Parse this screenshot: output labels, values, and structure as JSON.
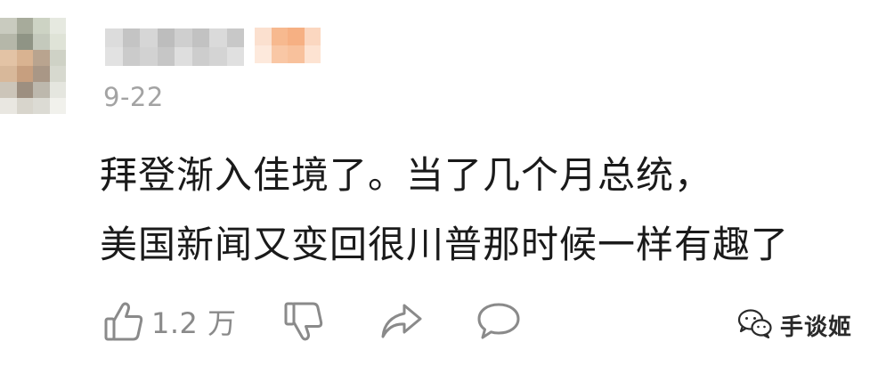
{
  "comment": {
    "date": "9-22",
    "lines": [
      "拜登渐入佳境了。当了几个月总统，",
      "美国新闻又变回很川普那时候一样有趣了"
    ]
  },
  "actions": {
    "like_count": "1.2 万",
    "like_icon": "thumbs-up-icon",
    "dislike_icon": "thumbs-down-icon",
    "share_icon": "share-icon",
    "reply_icon": "comment-bubble-icon"
  },
  "watermark": {
    "text": "手谈姬",
    "logo": "wechat-logo"
  },
  "colors": {
    "text_primary": "#1a1a1a",
    "text_secondary": "#a3a3a3",
    "icon_gray": "#8a8a8a"
  }
}
